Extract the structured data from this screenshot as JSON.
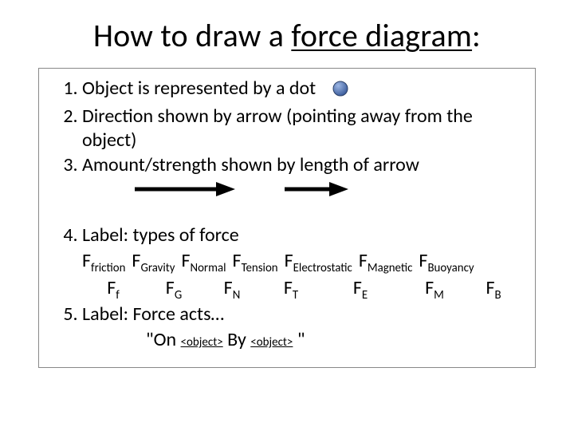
{
  "title_pre": "How to draw a ",
  "title_underline": "force diagram",
  "title_post": ":",
  "items": {
    "i1": "Object is represented by a dot",
    "i2": "Direction shown by arrow (pointing away from the object)",
    "i3": "Amount/strength shown by length of arrow",
    "i4": "Label: types of force",
    "i5": "Label: Force acts…"
  },
  "forces": [
    {
      "name": "friction",
      "sym": "f"
    },
    {
      "name": "Gravity",
      "sym": "G"
    },
    {
      "name": "Normal",
      "sym": "N"
    },
    {
      "name": "Tension",
      "sym": "T"
    },
    {
      "name": "Electrostatic",
      "sym": "E"
    },
    {
      "name": "Magnetic",
      "sym": "M"
    },
    {
      "name": "Buoyancy",
      "sym": "B"
    }
  ],
  "quote": {
    "open": "\"On ",
    "ph1": "<object>",
    "mid": " By ",
    "ph2": "<object>",
    "close": " \""
  },
  "icons": {
    "dot": "dot-icon",
    "arrow_long": "arrow-long-icon",
    "arrow_short": "arrow-short-icon"
  }
}
